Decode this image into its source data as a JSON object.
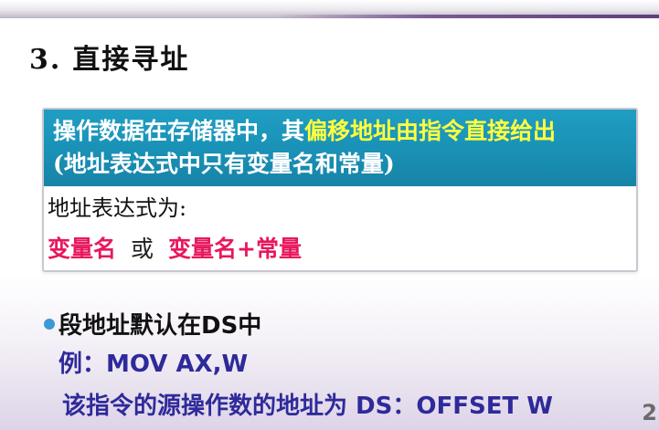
{
  "slide": {
    "title_number": "3.",
    "title_text": "直接寻址",
    "box": {
      "line1_plain": "操作数据在存储器中，其",
      "line1_highlight": "偏移地址由指令直接给出",
      "line2": "(地址表达式中只有变量名和常量)",
      "expr_label": "地址表达式为:",
      "form1": "变量名",
      "or_word": "或",
      "form2": "变量名+常量"
    },
    "bullet": "段地址默认在DS中",
    "example": "例：MOV AX,W",
    "explanation": "该指令的源操作数的地址为 DS：OFFSET W",
    "page_number": "2"
  },
  "colors": {
    "box_header": "#198fb4",
    "highlight_text": "#ffff3f",
    "form_text": "#e8175d",
    "example_text": "#2e2a9a",
    "bullet_dot": "#3b9ad6"
  },
  "icons": {
    "bullet": "filled-circle-bullet-icon"
  }
}
